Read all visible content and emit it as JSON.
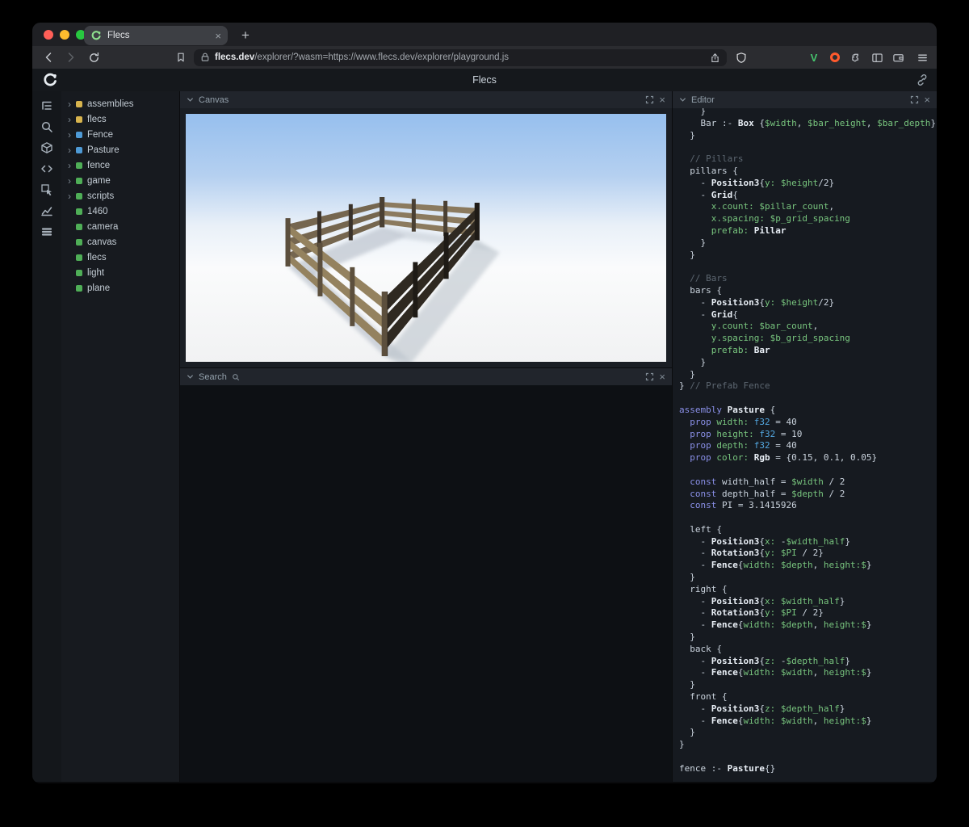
{
  "browser": {
    "tab_title": "Flecs",
    "new_tab_glyph": "+",
    "close_tab_glyph": "×",
    "url_host": "flecs.dev",
    "url_rest": "/explorer/?wasm=https://www.flecs.dev/explorer/playground.js",
    "extension_v_label": "V",
    "traffic_lights": {
      "close": "#ff5f57",
      "minimize": "#febc2e",
      "zoom": "#28c840"
    },
    "icons": [
      "back",
      "forward",
      "reload",
      "bookmark",
      "lock",
      "share",
      "brave-shield",
      "extension-v",
      "extension-orange",
      "puzzle",
      "sidebar-toggle",
      "wallet",
      "menu"
    ]
  },
  "app": {
    "title": "Flecs",
    "logo_icon": "flecs-logo",
    "link_icon": "link-icon"
  },
  "sidebar_icons": [
    "tree-icon",
    "search-icon",
    "cube-icon",
    "code-icon",
    "pointer-icon",
    "chart-icon",
    "rows-icon"
  ],
  "tree": {
    "colors": {
      "yellow": "#d8b44e",
      "blue": "#4e9ad6",
      "green": "#4fae57"
    },
    "items": [
      {
        "label": "assemblies",
        "color": "yellow",
        "expandable": true
      },
      {
        "label": "flecs",
        "color": "yellow",
        "expandable": true
      },
      {
        "label": "Fence",
        "color": "blue",
        "expandable": true
      },
      {
        "label": "Pasture",
        "color": "blue",
        "expandable": true
      },
      {
        "label": "fence",
        "color": "green",
        "expandable": true
      },
      {
        "label": "game",
        "color": "green",
        "expandable": true
      },
      {
        "label": "scripts",
        "color": "green",
        "expandable": true
      },
      {
        "label": "1460",
        "color": "green",
        "expandable": false
      },
      {
        "label": "camera",
        "color": "green",
        "expandable": false
      },
      {
        "label": "canvas",
        "color": "green",
        "expandable": false
      },
      {
        "label": "flecs",
        "color": "green",
        "expandable": false
      },
      {
        "label": "light",
        "color": "green",
        "expandable": false
      },
      {
        "label": "plane",
        "color": "green",
        "expandable": false
      }
    ]
  },
  "panels": {
    "canvas_title": "Canvas",
    "search_title": "Search",
    "editor_title": "Editor",
    "close_glyph": "×"
  },
  "editor": {
    "lines": [
      [
        [
          "w",
          "    }"
        ]
      ],
      [
        [
          "w",
          "    Bar :- "
        ],
        [
          "t",
          "Box"
        ],
        [
          "w",
          " {"
        ],
        [
          "g",
          "$width"
        ],
        [
          "w",
          ", "
        ],
        [
          "g",
          "$bar_height"
        ],
        [
          "w",
          ", "
        ],
        [
          "g",
          "$bar_depth"
        ],
        [
          "w",
          "}"
        ]
      ],
      [
        [
          "w",
          "  }"
        ]
      ],
      [],
      [
        [
          "c",
          "  // Pillars"
        ]
      ],
      [
        [
          "w",
          "  pillars {"
        ]
      ],
      [
        [
          "w",
          "    - "
        ],
        [
          "t",
          "Position3"
        ],
        [
          "w",
          "{"
        ],
        [
          "g",
          "y:"
        ],
        [
          "w",
          " "
        ],
        [
          "g",
          "$height"
        ],
        [
          "w",
          "/2}"
        ]
      ],
      [
        [
          "w",
          "    - "
        ],
        [
          "t",
          "Grid"
        ],
        [
          "w",
          "{"
        ]
      ],
      [
        [
          "g",
          "      x.count:"
        ],
        [
          "w",
          " "
        ],
        [
          "g",
          "$pillar_count"
        ],
        [
          "w",
          ","
        ]
      ],
      [
        [
          "g",
          "      x.spacing:"
        ],
        [
          "w",
          " "
        ],
        [
          "g",
          "$p_grid_spacing"
        ]
      ],
      [
        [
          "g",
          "      prefab:"
        ],
        [
          "w",
          " "
        ],
        [
          "t",
          "Pillar"
        ]
      ],
      [
        [
          "w",
          "    }"
        ]
      ],
      [
        [
          "w",
          "  }"
        ]
      ],
      [],
      [
        [
          "c",
          "  // Bars"
        ]
      ],
      [
        [
          "w",
          "  bars {"
        ]
      ],
      [
        [
          "w",
          "    - "
        ],
        [
          "t",
          "Position3"
        ],
        [
          "w",
          "{"
        ],
        [
          "g",
          "y:"
        ],
        [
          "w",
          " "
        ],
        [
          "g",
          "$height"
        ],
        [
          "w",
          "/2}"
        ]
      ],
      [
        [
          "w",
          "    - "
        ],
        [
          "t",
          "Grid"
        ],
        [
          "w",
          "{"
        ]
      ],
      [
        [
          "g",
          "      y.count:"
        ],
        [
          "w",
          " "
        ],
        [
          "g",
          "$bar_count"
        ],
        [
          "w",
          ","
        ]
      ],
      [
        [
          "g",
          "      y.spacing:"
        ],
        [
          "w",
          " "
        ],
        [
          "g",
          "$b_grid_spacing"
        ]
      ],
      [
        [
          "g",
          "      prefab:"
        ],
        [
          "w",
          " "
        ],
        [
          "t",
          "Bar"
        ]
      ],
      [
        [
          "w",
          "    }"
        ]
      ],
      [
        [
          "w",
          "  }"
        ]
      ],
      [
        [
          "w",
          "} "
        ],
        [
          "c",
          "// Prefab Fence"
        ]
      ],
      [],
      [
        [
          "k",
          "assembly"
        ],
        [
          "w",
          " "
        ],
        [
          "t",
          "Pasture"
        ],
        [
          "w",
          " {"
        ]
      ],
      [
        [
          "k",
          "  prop"
        ],
        [
          "w",
          " "
        ],
        [
          "g",
          "width:"
        ],
        [
          "w",
          " "
        ],
        [
          "b",
          "f32"
        ],
        [
          "w",
          " = "
        ],
        [
          "n",
          "40"
        ]
      ],
      [
        [
          "k",
          "  prop"
        ],
        [
          "w",
          " "
        ],
        [
          "g",
          "height:"
        ],
        [
          "w",
          " "
        ],
        [
          "b",
          "f32"
        ],
        [
          "w",
          " = "
        ],
        [
          "n",
          "10"
        ]
      ],
      [
        [
          "k",
          "  prop"
        ],
        [
          "w",
          " "
        ],
        [
          "g",
          "depth:"
        ],
        [
          "w",
          " "
        ],
        [
          "b",
          "f32"
        ],
        [
          "w",
          " = "
        ],
        [
          "n",
          "40"
        ]
      ],
      [
        [
          "k",
          "  prop"
        ],
        [
          "w",
          " "
        ],
        [
          "g",
          "color:"
        ],
        [
          "w",
          " "
        ],
        [
          "t",
          "Rgb"
        ],
        [
          "w",
          " = {"
        ],
        [
          "n",
          "0.15"
        ],
        [
          "w",
          ", "
        ],
        [
          "n",
          "0.1"
        ],
        [
          "w",
          ", "
        ],
        [
          "n",
          "0.05"
        ],
        [
          "w",
          "}"
        ]
      ],
      [],
      [
        [
          "k",
          "  const"
        ],
        [
          "w",
          " width_half = "
        ],
        [
          "g",
          "$width"
        ],
        [
          "w",
          " / "
        ],
        [
          "n",
          "2"
        ]
      ],
      [
        [
          "k",
          "  const"
        ],
        [
          "w",
          " depth_half = "
        ],
        [
          "g",
          "$depth"
        ],
        [
          "w",
          " / "
        ],
        [
          "n",
          "2"
        ]
      ],
      [
        [
          "k",
          "  const"
        ],
        [
          "w",
          " PI = "
        ],
        [
          "n",
          "3.1415926"
        ]
      ],
      [],
      [
        [
          "w",
          "  left {"
        ]
      ],
      [
        [
          "w",
          "    - "
        ],
        [
          "t",
          "Position3"
        ],
        [
          "w",
          "{"
        ],
        [
          "g",
          "x:"
        ],
        [
          "w",
          " -"
        ],
        [
          "g",
          "$width_half"
        ],
        [
          "w",
          "}"
        ]
      ],
      [
        [
          "w",
          "    - "
        ],
        [
          "t",
          "Rotation3"
        ],
        [
          "w",
          "{"
        ],
        [
          "g",
          "y:"
        ],
        [
          "w",
          " "
        ],
        [
          "g",
          "$PI"
        ],
        [
          "w",
          " / "
        ],
        [
          "n",
          "2"
        ],
        [
          "w",
          "}"
        ]
      ],
      [
        [
          "w",
          "    - "
        ],
        [
          "t",
          "Fence"
        ],
        [
          "w",
          "{"
        ],
        [
          "g",
          "width:"
        ],
        [
          "w",
          " "
        ],
        [
          "g",
          "$depth"
        ],
        [
          "w",
          ", "
        ],
        [
          "g",
          "height:"
        ],
        [
          "g",
          "$"
        ],
        [
          "w",
          "}"
        ]
      ],
      [
        [
          "w",
          "  }"
        ]
      ],
      [
        [
          "w",
          "  right {"
        ]
      ],
      [
        [
          "w",
          "    - "
        ],
        [
          "t",
          "Position3"
        ],
        [
          "w",
          "{"
        ],
        [
          "g",
          "x:"
        ],
        [
          "w",
          " "
        ],
        [
          "g",
          "$width_half"
        ],
        [
          "w",
          "}"
        ]
      ],
      [
        [
          "w",
          "    - "
        ],
        [
          "t",
          "Rotation3"
        ],
        [
          "w",
          "{"
        ],
        [
          "g",
          "y:"
        ],
        [
          "w",
          " "
        ],
        [
          "g",
          "$PI"
        ],
        [
          "w",
          " / "
        ],
        [
          "n",
          "2"
        ],
        [
          "w",
          "}"
        ]
      ],
      [
        [
          "w",
          "    - "
        ],
        [
          "t",
          "Fence"
        ],
        [
          "w",
          "{"
        ],
        [
          "g",
          "width:"
        ],
        [
          "w",
          " "
        ],
        [
          "g",
          "$depth"
        ],
        [
          "w",
          ", "
        ],
        [
          "g",
          "height:"
        ],
        [
          "g",
          "$"
        ],
        [
          "w",
          "}"
        ]
      ],
      [
        [
          "w",
          "  }"
        ]
      ],
      [
        [
          "w",
          "  back {"
        ]
      ],
      [
        [
          "w",
          "    - "
        ],
        [
          "t",
          "Position3"
        ],
        [
          "w",
          "{"
        ],
        [
          "g",
          "z:"
        ],
        [
          "w",
          " -"
        ],
        [
          "g",
          "$depth_half"
        ],
        [
          "w",
          "}"
        ]
      ],
      [
        [
          "w",
          "    - "
        ],
        [
          "t",
          "Fence"
        ],
        [
          "w",
          "{"
        ],
        [
          "g",
          "width:"
        ],
        [
          "w",
          " "
        ],
        [
          "g",
          "$width"
        ],
        [
          "w",
          ", "
        ],
        [
          "g",
          "height:"
        ],
        [
          "g",
          "$"
        ],
        [
          "w",
          "}"
        ]
      ],
      [
        [
          "w",
          "  }"
        ]
      ],
      [
        [
          "w",
          "  front {"
        ]
      ],
      [
        [
          "w",
          "    - "
        ],
        [
          "t",
          "Position3"
        ],
        [
          "w",
          "{"
        ],
        [
          "g",
          "z:"
        ],
        [
          "w",
          " "
        ],
        [
          "g",
          "$depth_half"
        ],
        [
          "w",
          "}"
        ]
      ],
      [
        [
          "w",
          "    - "
        ],
        [
          "t",
          "Fence"
        ],
        [
          "w",
          "{"
        ],
        [
          "g",
          "width:"
        ],
        [
          "w",
          " "
        ],
        [
          "g",
          "$width"
        ],
        [
          "w",
          ", "
        ],
        [
          "g",
          "height:"
        ],
        [
          "g",
          "$"
        ],
        [
          "w",
          "}"
        ]
      ],
      [
        [
          "w",
          "  }"
        ]
      ],
      [
        [
          "w",
          "}"
        ]
      ],
      [],
      [
        [
          "w",
          "fence :- "
        ],
        [
          "t",
          "Pasture"
        ],
        [
          "w",
          "{}"
        ]
      ]
    ]
  }
}
